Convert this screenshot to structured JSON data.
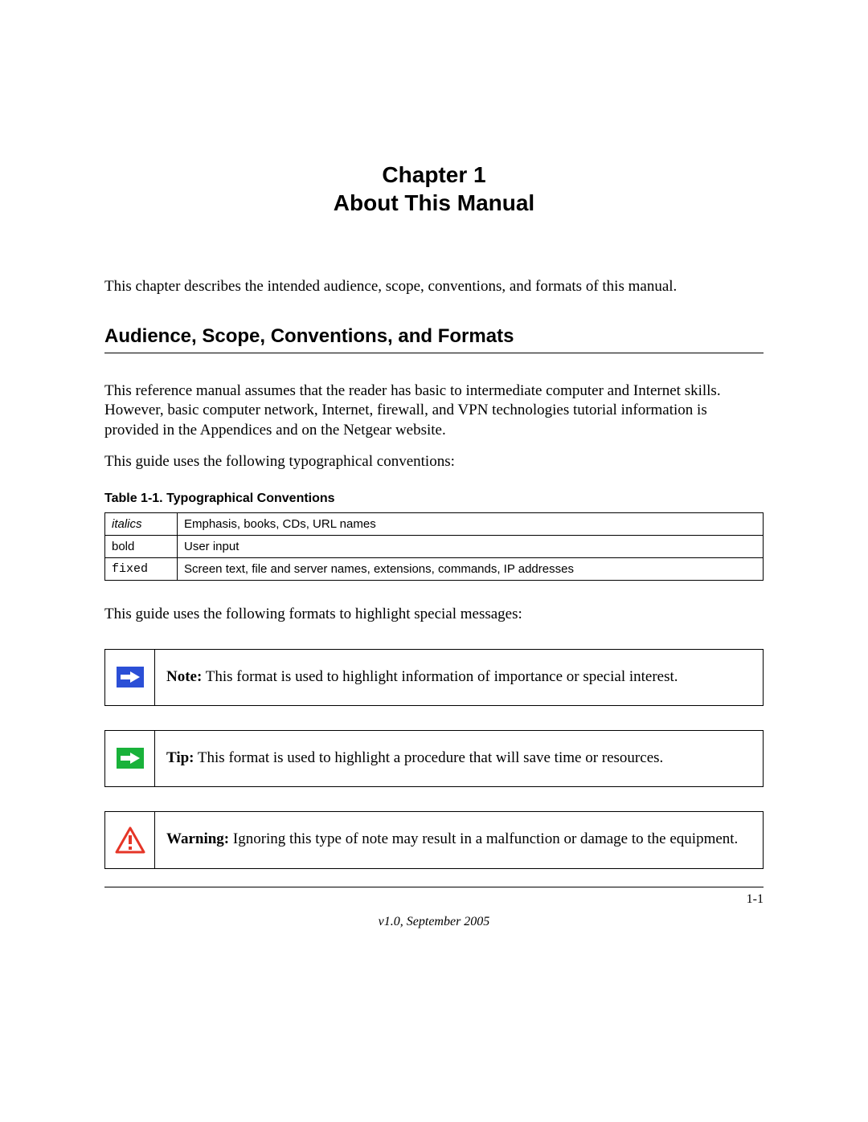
{
  "heading": {
    "line1": "Chapter 1",
    "line2": "About This Manual"
  },
  "intro": "This chapter describes the intended audience, scope, conventions, and formats of this manual.",
  "section_title": "Audience, Scope, Conventions, and Formats",
  "para1": "This reference manual assumes that the reader has basic to intermediate computer and Internet skills. However, basic computer network, Internet, firewall, and VPN technologies tutorial information is provided in the Appendices and on the Netgear website.",
  "para2": "This guide uses the following typographical conventions:",
  "table": {
    "caption": "Table 1-1. Typographical Conventions",
    "rows": [
      {
        "label": "italics",
        "style": "italics",
        "desc": "Emphasis, books, CDs, URL names"
      },
      {
        "label": "bold",
        "style": "plain",
        "desc": "User input"
      },
      {
        "label": "fixed",
        "style": "fixed",
        "desc": "Screen text, file and server names, extensions, commands, IP addresses"
      }
    ]
  },
  "para3": "This guide uses the following formats to highlight special messages:",
  "callouts": {
    "note": {
      "label": "Note:",
      "text": " This format is used to highlight information of importance or special interest."
    },
    "tip": {
      "label": "Tip:",
      "text": " This format is used to highlight a procedure that will save time or resources."
    },
    "warning": {
      "label": "Warning:",
      "text": " Ignoring this type of note may result in a malfunction or damage to the equipment."
    }
  },
  "footer": {
    "page_number": "1-1",
    "version": "v1.0, September 2005"
  },
  "colors": {
    "note_icon_bg": "#2b4fd6",
    "tip_icon_bg": "#19b23a",
    "warning_icon": "#e53527"
  }
}
